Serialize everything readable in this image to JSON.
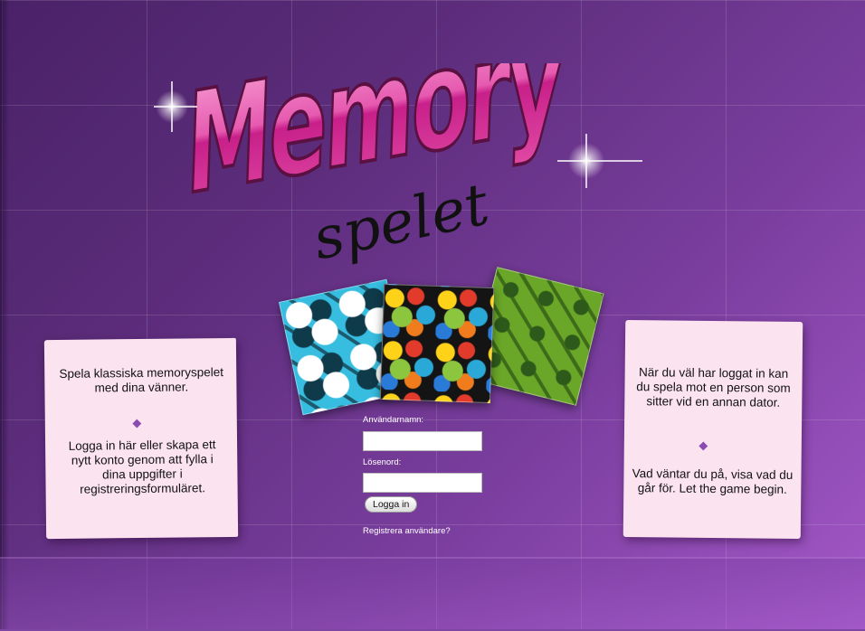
{
  "logo": {
    "title": "Memory",
    "subtitle": "spelet"
  },
  "left_note": {
    "paragraph1": "Spela klassiska memoryspelet med dina vänner.",
    "paragraph2": "Logga in här eller skapa ett nytt konto genom att fylla i dina uppgifter i registreringsformuläret."
  },
  "right_note": {
    "paragraph1": "När du väl har loggat in kan du spela mot en person som sitter vid en annan dator.",
    "paragraph2": "Vad väntar du på, visa vad du går för. Let the game begin."
  },
  "login": {
    "username_label": "Användarnamn:",
    "username_value": "",
    "password_label": "Lösenord:",
    "password_value": "",
    "submit_label": "Logga in",
    "register_link": "Registrera användare?"
  },
  "colors": {
    "background": "#6a3a8c",
    "logo_pink": "#e0449e",
    "note_bg": "#fbe3f0",
    "diamond": "#8a4cb0"
  }
}
